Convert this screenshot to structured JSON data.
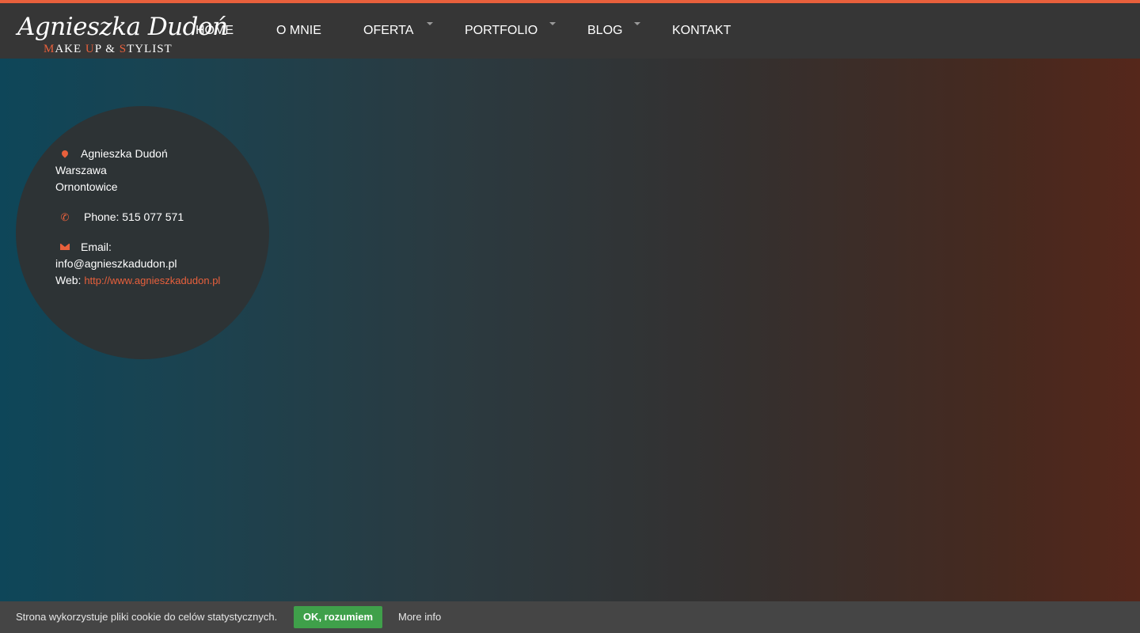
{
  "brand": {
    "name": "Agnieszka Dudoń",
    "tagline_parts": [
      "M",
      "AKE ",
      "U",
      "P & ",
      "S",
      "TYLIST"
    ]
  },
  "colors": {
    "accent": "#e8603c",
    "header": "#363636",
    "circle": "#2d3335",
    "cookie_button": "#3fa04a"
  },
  "nav": [
    {
      "label": "HOME",
      "has_submenu": false
    },
    {
      "label": "O MNIE",
      "has_submenu": false
    },
    {
      "label": "OFERTA",
      "has_submenu": true
    },
    {
      "label": "PORTFOLIO",
      "has_submenu": true
    },
    {
      "label": "BLOG",
      "has_submenu": true
    },
    {
      "label": "KONTAKT",
      "has_submenu": false
    }
  ],
  "contact": {
    "name": "Agnieszka Dudoń",
    "city1": "Warszawa",
    "city2": "Ornontowice",
    "phone": "Phone: 515 077 571",
    "email_label": "Email:",
    "email": "info@agnieszkadudon.pl",
    "web_label": "Web:",
    "web_url": "http://www.agnieszkadudon.pl",
    "icons": [
      "map-marker-icon",
      "phone-icon",
      "envelope-icon"
    ]
  },
  "cookie": {
    "text": "Strona wykorzystuje pliki cookie do celów statystycznych.",
    "ok_label": "OK, rozumiem",
    "more_label": "More info"
  }
}
